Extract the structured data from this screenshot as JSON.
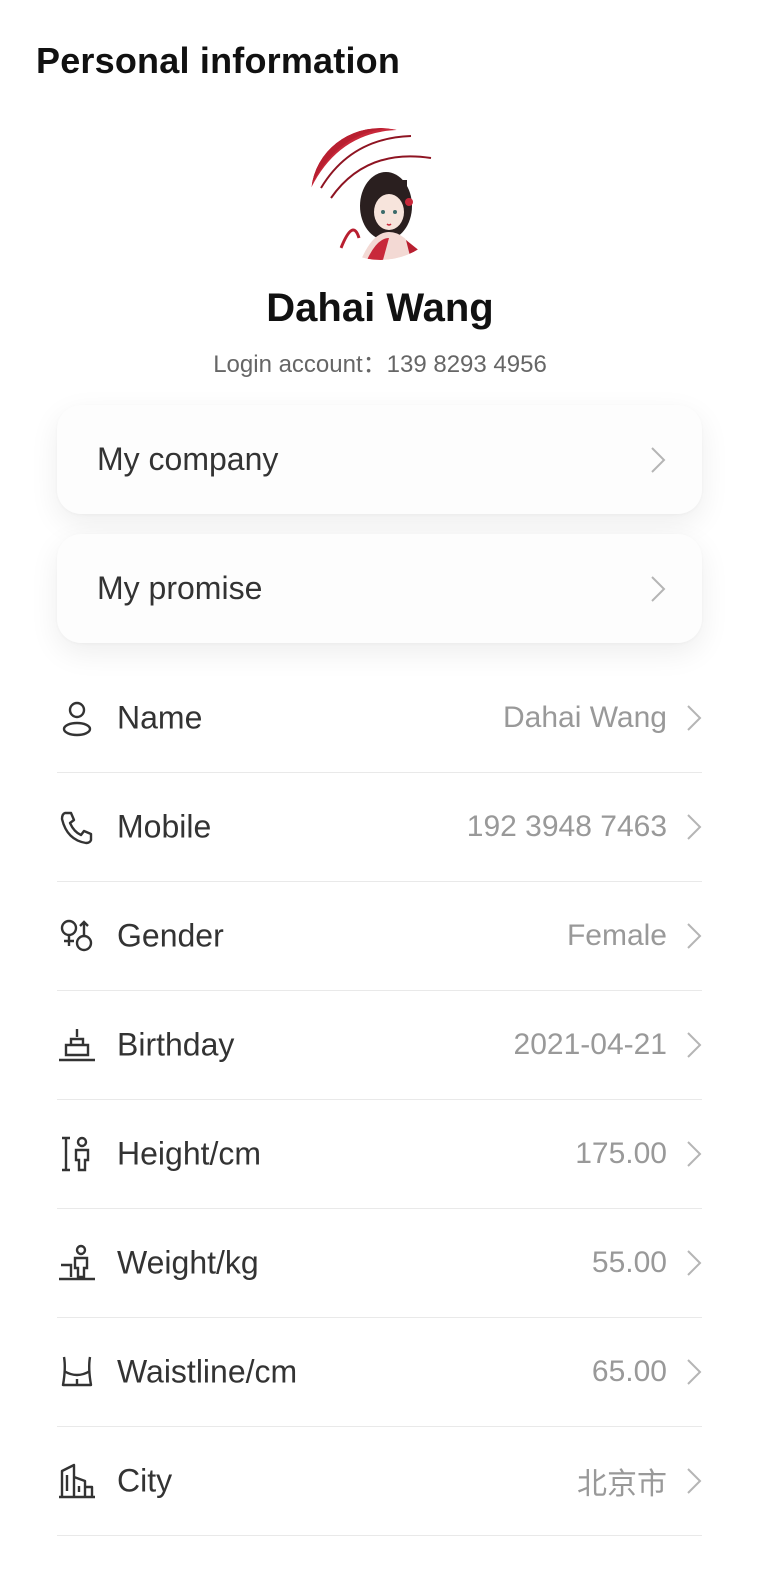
{
  "header": {
    "title": "Personal information"
  },
  "profile": {
    "name": "Dahai Wang",
    "login_account": "Login account：139 8293 4956"
  },
  "cards": {
    "company_label": "My company",
    "promise_label": "My promise"
  },
  "fields": [
    {
      "icon": "person-icon",
      "label": "Name",
      "value": "Dahai Wang"
    },
    {
      "icon": "phone-icon",
      "label": "Mobile",
      "value": "192 3948 7463"
    },
    {
      "icon": "gender-icon",
      "label": "Gender",
      "value": "Female"
    },
    {
      "icon": "cake-icon",
      "label": "Birthday",
      "value": "2021-04-21"
    },
    {
      "icon": "height-icon",
      "label": "Height/cm",
      "value": "175.00"
    },
    {
      "icon": "weight-icon",
      "label": "Weight/kg",
      "value": "55.00"
    },
    {
      "icon": "waist-icon",
      "label": "Waistline/cm",
      "value": "65.00"
    },
    {
      "icon": "city-icon",
      "label": "City",
      "value": "北京市"
    }
  ],
  "colors": {
    "text_primary": "#111111",
    "text_secondary": "#999999",
    "divider": "#e9e9e9",
    "avatar_accent": "#c8283a"
  }
}
